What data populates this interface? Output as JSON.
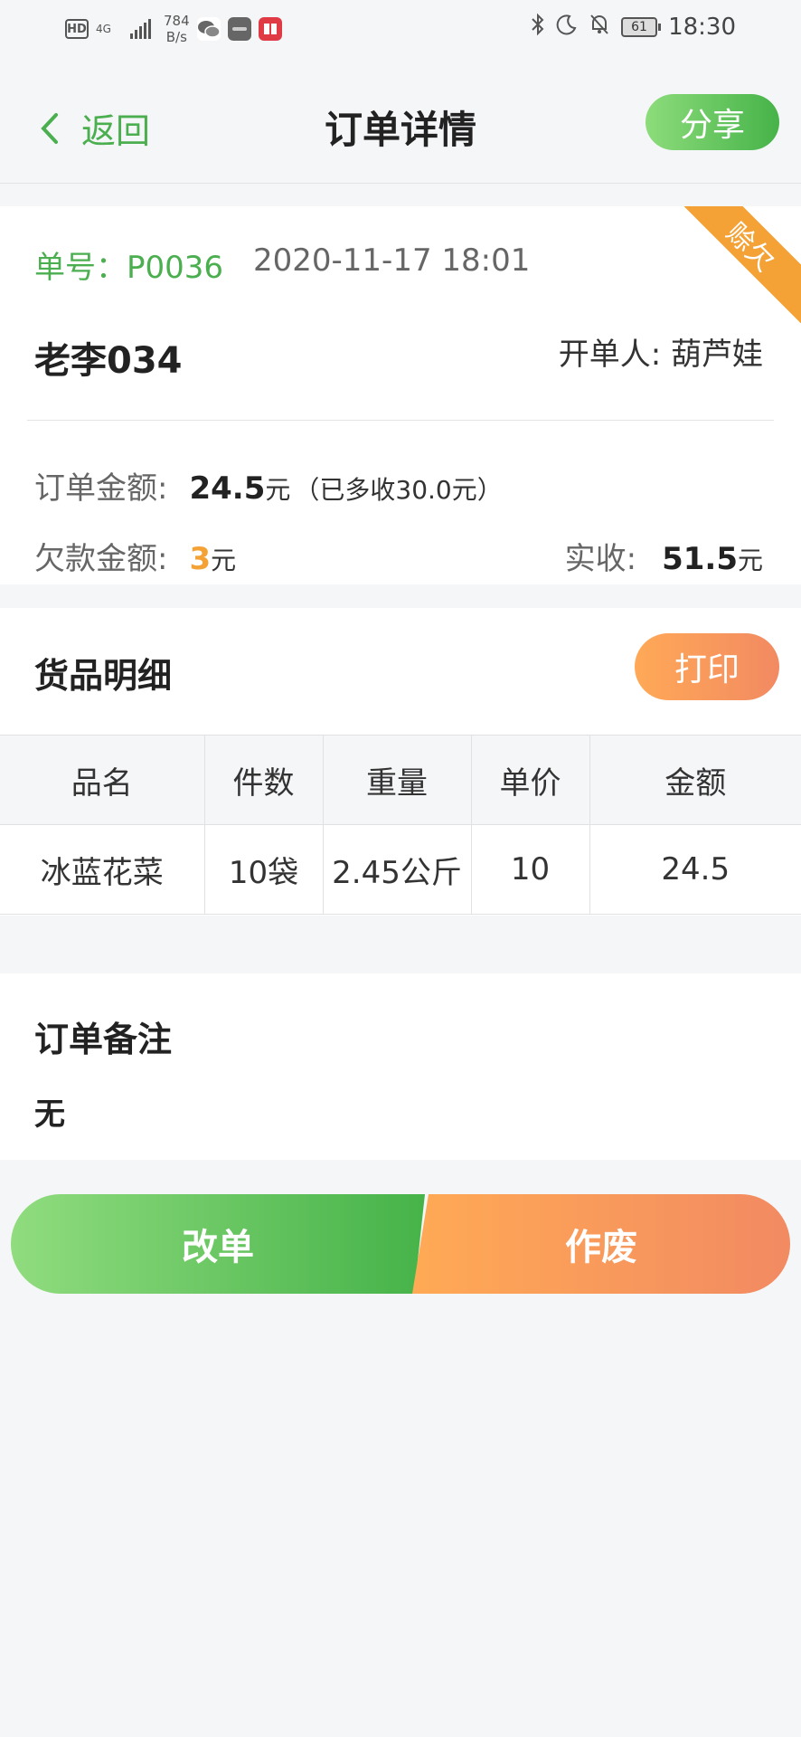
{
  "status_bar": {
    "hd": "HD",
    "network": "4G",
    "speed_value": "784",
    "speed_unit": "B/s",
    "battery": "61",
    "time": "18:30"
  },
  "header": {
    "back_label": "返回",
    "title": "订单详情",
    "share_label": "分享"
  },
  "order": {
    "ribbon": "赊欠",
    "number": "单号：P0036",
    "datetime": "2020-11-17 18:01",
    "customer": "老李034",
    "opener": "开单人: 葫芦娃",
    "amount_label": "订单金额:",
    "amount_value": "24.5",
    "amount_unit": "元",
    "amount_extra": "（已多收30.0元）",
    "debt_label": "欠款金额:",
    "debt_value": "3",
    "debt_unit": "元",
    "received_label": "实收:",
    "received_value": "51.5",
    "received_unit": "元"
  },
  "goods": {
    "title": "货品明细",
    "print_label": "打印",
    "columns": [
      "品名",
      "件数",
      "重量",
      "单价",
      "金额"
    ],
    "rows": [
      [
        "冰蓝花菜",
        "10袋",
        "2.45公斤",
        "10",
        "24.5"
      ]
    ]
  },
  "remarks": {
    "title": "订单备注",
    "text": "无"
  },
  "actions": {
    "edit_label": "改单",
    "void_label": "作废"
  },
  "colors": {
    "green": "#4bae4f",
    "orange": "#f4a236"
  }
}
